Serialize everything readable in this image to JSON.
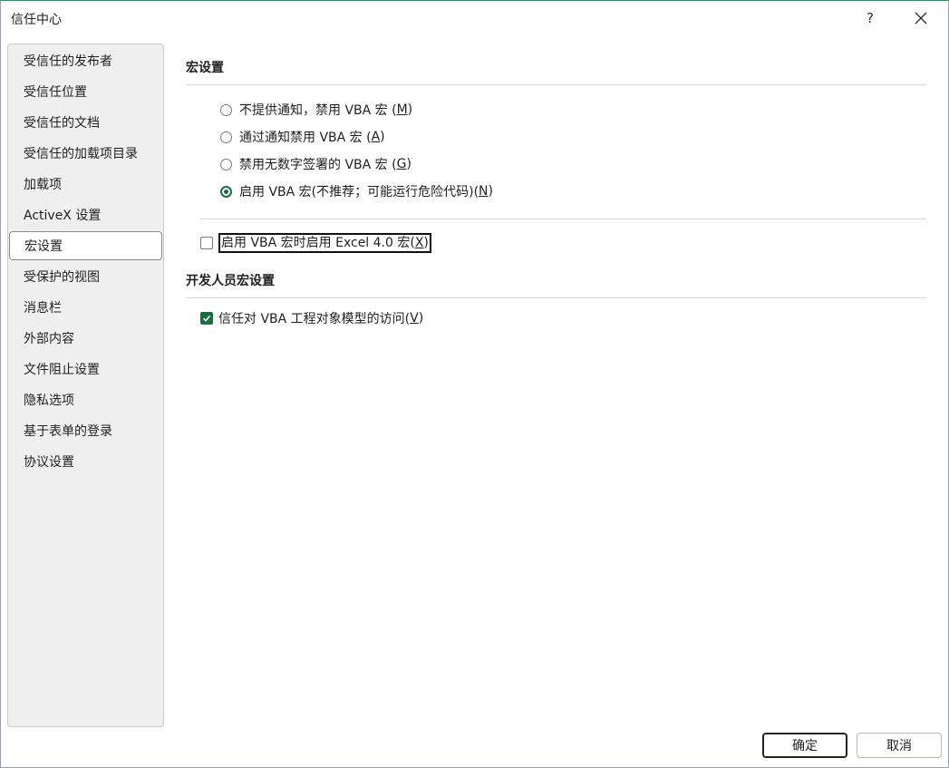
{
  "window": {
    "title": "信任中心",
    "help_label": "?"
  },
  "sidebar": {
    "items": [
      {
        "label": "受信任的发布者"
      },
      {
        "label": "受信任位置"
      },
      {
        "label": "受信任的文档"
      },
      {
        "label": "受信任的加载项目录"
      },
      {
        "label": "加载项"
      },
      {
        "label": "ActiveX 设置"
      },
      {
        "label": "宏设置",
        "selected": true
      },
      {
        "label": "受保护的视图"
      },
      {
        "label": "消息栏"
      },
      {
        "label": "外部内容"
      },
      {
        "label": "文件阻止设置"
      },
      {
        "label": "隐私选项"
      },
      {
        "label": "基于表单的登录"
      },
      {
        "label": "协议设置"
      }
    ]
  },
  "macro_settings": {
    "title": "宏设置",
    "options": [
      {
        "text": "不提供通知，禁用 VBA 宏 (",
        "key": "M",
        "tail": ")",
        "checked": false
      },
      {
        "text": "通过通知禁用 VBA 宏 (",
        "key": "A",
        "tail": ")",
        "checked": false
      },
      {
        "text": "禁用无数字签署的 VBA 宏 (",
        "key": "G",
        "tail": ")",
        "checked": false
      },
      {
        "text": "启用 VBA 宏(不推荐；可能运行危险代码)(",
        "key": "N",
        "tail": ")",
        "checked": true
      }
    ],
    "excel4_checkbox": {
      "text": "启用 VBA 宏时启用 Excel 4.0 宏(",
      "key": "X",
      "tail": ")",
      "checked": false
    }
  },
  "developer_settings": {
    "title": "开发人员宏设置",
    "trust_vba_checkbox": {
      "text": "信任对 VBA 工程对象模型的访问(",
      "key": "V",
      "tail": ")",
      "checked": true
    }
  },
  "footer": {
    "ok_label": "确定",
    "cancel_label": "取消"
  },
  "colors": {
    "accent": "#1b6e3f"
  }
}
